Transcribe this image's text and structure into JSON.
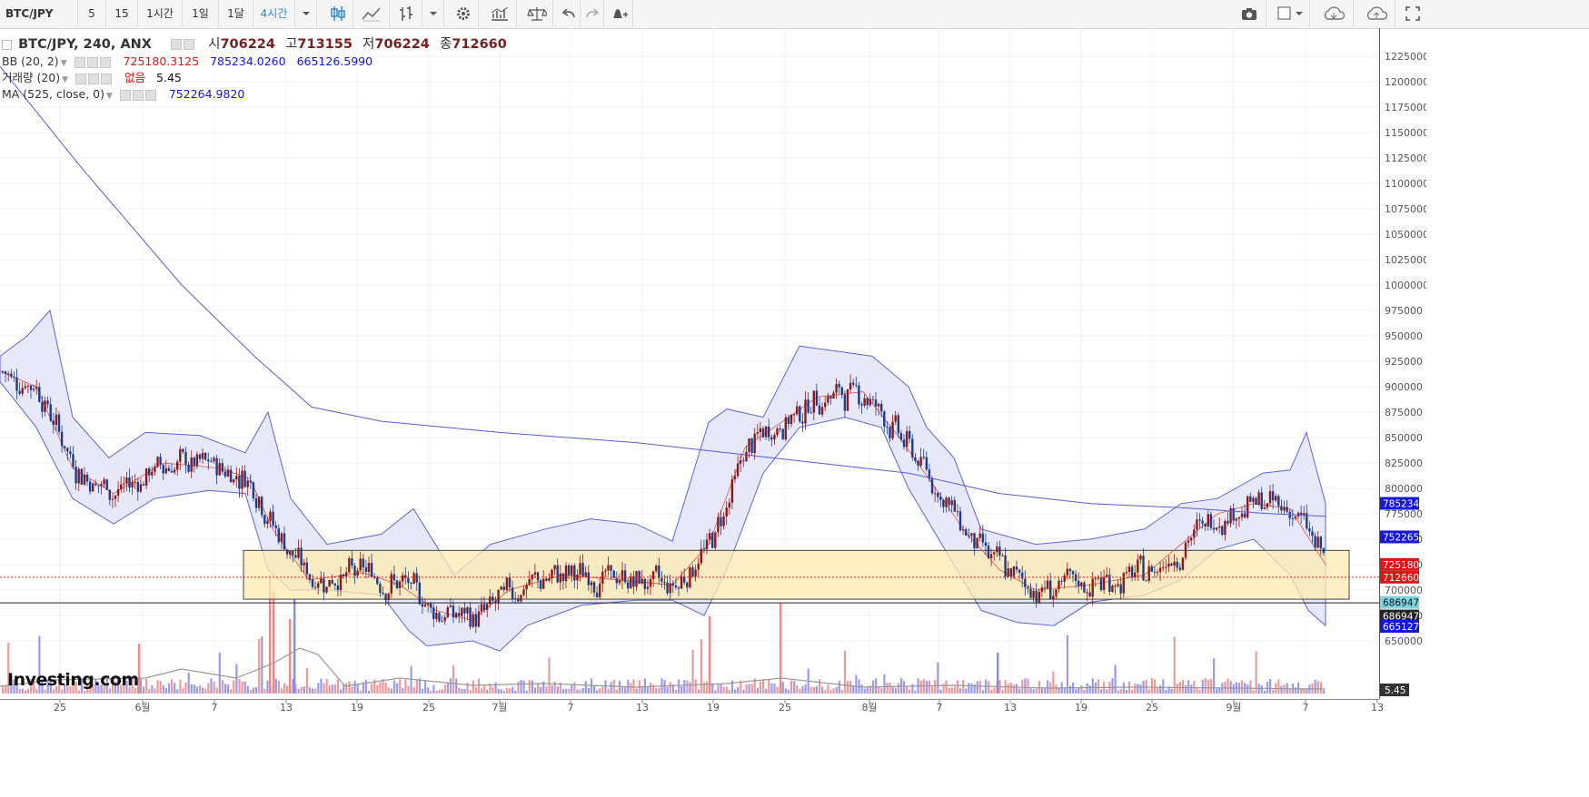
{
  "toolbar": {
    "symbol": "BTC/JPY",
    "intervals": [
      "5",
      "15",
      "1시간",
      "1일",
      "1달",
      "4시간"
    ],
    "active_interval": "4시간"
  },
  "legend": {
    "main": {
      "name": "BTC/JPY, 240, ANX",
      "open_label": "시",
      "open": "706224",
      "high_label": "고",
      "high": "713155",
      "low_label": "저",
      "low": "706224",
      "close_label": "종",
      "close": "712660"
    },
    "bb": {
      "name": "BB (20, 2)",
      "mid": "725180.3125",
      "upper": "785234.0260",
      "lower": "665126.5990"
    },
    "volume": {
      "name": "거래량 (20)",
      "none": "없음",
      "value": "5.45"
    },
    "ma": {
      "name": "MA (525, close, 0)",
      "value": "752264.9820"
    }
  },
  "colors": {
    "up": "#8b1a1a",
    "down": "#1f3c88",
    "bb_line": "#5b67d6",
    "bb_fill": "#e4e5f7",
    "ma": "#5b5bd6",
    "zone_fill": "#fde9b0",
    "zone_border": "#444444",
    "current_line": "#e02020",
    "tag_red": "#e01515",
    "tag_blue": "#1515e0",
    "tag_teal": "#7fd3de",
    "tag_black": "#222222",
    "tag_dark": "#333333",
    "vol_up": "#e88a8a",
    "vol_down": "#8a8ae8",
    "vol_ma": "#999999"
  },
  "chart_data": {
    "type": "line",
    "title": "BTC/JPY, 240, ANX",
    "ylim": [
      640000,
      1250000
    ],
    "y_ticks": [
      650000,
      675000,
      700000,
      725000,
      750000,
      775000,
      800000,
      825000,
      850000,
      875000,
      900000,
      925000,
      950000,
      975000,
      1000000,
      1025000,
      1050000,
      1075000,
      1100000,
      1125000,
      1150000,
      1175000,
      1200000,
      1225000
    ],
    "x_labels": [
      "25",
      "6월",
      "7",
      "13",
      "19",
      "25",
      "7월",
      "7",
      "13",
      "19",
      "25",
      "8월",
      "7",
      "13",
      "19",
      "25",
      "9월",
      "7",
      "13"
    ],
    "series": [
      {
        "name": "MA (525, close, 0)",
        "x": [
          "5월 22",
          "6월 13",
          "7월 19",
          "8월 7",
          "8월 25",
          "9월 7"
        ],
        "values": [
          1180000,
          877000,
          840000,
          810000,
          780000,
          752265
        ]
      },
      {
        "name": "BB (20, 2)",
        "x": [
          "5월 25",
          "6월 1",
          "6월 7",
          "6월 13",
          "6월 19",
          "6월 25",
          "7월 1",
          "7월 7",
          "7月13",
          "7월 19",
          "7월 25",
          "8월 1",
          "8월 7",
          "8월 13",
          "8월 19",
          "8월 25",
          "9월 1",
          "9월 7"
        ],
        "values": [
          920000,
          820000,
          830000,
          760000,
          735000,
          700000,
          710000,
          735000,
          715000,
          810000,
          905000,
          880000,
          790000,
          705000,
          710000,
          740000,
          790000,
          725180
        ]
      }
    ],
    "ohlc_last": {
      "open": 706224,
      "high": 713155,
      "low": 706224,
      "close": 712660
    },
    "levels": {
      "current": 712660,
      "bb_mid": 725180,
      "bb_upper": 785234,
      "bb_lower": 665127,
      "ma": 752265,
      "support": 686947
    },
    "zone": {
      "from": 691000,
      "to": 739000
    },
    "volume_last": 5.45,
    "price_tags": [
      "785234",
      "752265",
      "725180",
      "712660",
      "686947",
      "686947",
      "665127"
    ],
    "volume_tag": "5.45",
    "watermark": "Investing.com"
  }
}
